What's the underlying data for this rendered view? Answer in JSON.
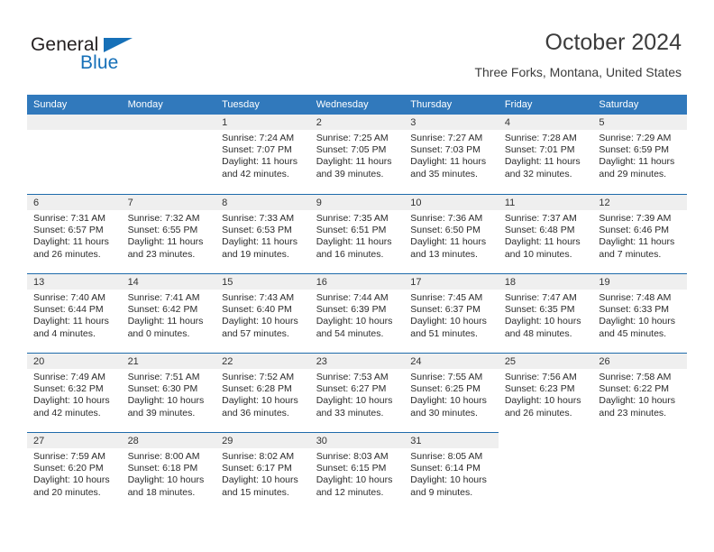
{
  "brand": {
    "line1": "General",
    "line2": "Blue",
    "flag_icon": "triangle-flag-icon",
    "colors": {
      "general": "#231f20",
      "blue": "#1670b8"
    }
  },
  "header": {
    "title": "October 2024",
    "subtitle": "Three Forks, Montana, United States"
  },
  "theme": {
    "header_blue": "#3179bc",
    "rule_blue": "#1f6bab",
    "daynum_band": "#efefef",
    "text": "#2b2b2b"
  },
  "weekday_headers": [
    "Sunday",
    "Monday",
    "Tuesday",
    "Wednesday",
    "Thursday",
    "Friday",
    "Saturday"
  ],
  "weeks": [
    [
      {
        "day": "",
        "filled": false,
        "lines": []
      },
      {
        "day": "",
        "filled": false,
        "lines": []
      },
      {
        "day": "1",
        "filled": true,
        "lines": [
          "Sunrise: 7:24 AM",
          "Sunset: 7:07 PM",
          "Daylight: 11 hours",
          "and 42 minutes."
        ]
      },
      {
        "day": "2",
        "filled": true,
        "lines": [
          "Sunrise: 7:25 AM",
          "Sunset: 7:05 PM",
          "Daylight: 11 hours",
          "and 39 minutes."
        ]
      },
      {
        "day": "3",
        "filled": true,
        "lines": [
          "Sunrise: 7:27 AM",
          "Sunset: 7:03 PM",
          "Daylight: 11 hours",
          "and 35 minutes."
        ]
      },
      {
        "day": "4",
        "filled": true,
        "lines": [
          "Sunrise: 7:28 AM",
          "Sunset: 7:01 PM",
          "Daylight: 11 hours",
          "and 32 minutes."
        ]
      },
      {
        "day": "5",
        "filled": true,
        "lines": [
          "Sunrise: 7:29 AM",
          "Sunset: 6:59 PM",
          "Daylight: 11 hours",
          "and 29 minutes."
        ]
      }
    ],
    [
      {
        "day": "6",
        "filled": true,
        "lines": [
          "Sunrise: 7:31 AM",
          "Sunset: 6:57 PM",
          "Daylight: 11 hours",
          "and 26 minutes."
        ]
      },
      {
        "day": "7",
        "filled": true,
        "lines": [
          "Sunrise: 7:32 AM",
          "Sunset: 6:55 PM",
          "Daylight: 11 hours",
          "and 23 minutes."
        ]
      },
      {
        "day": "8",
        "filled": true,
        "lines": [
          "Sunrise: 7:33 AM",
          "Sunset: 6:53 PM",
          "Daylight: 11 hours",
          "and 19 minutes."
        ]
      },
      {
        "day": "9",
        "filled": true,
        "lines": [
          "Sunrise: 7:35 AM",
          "Sunset: 6:51 PM",
          "Daylight: 11 hours",
          "and 16 minutes."
        ]
      },
      {
        "day": "10",
        "filled": true,
        "lines": [
          "Sunrise: 7:36 AM",
          "Sunset: 6:50 PM",
          "Daylight: 11 hours",
          "and 13 minutes."
        ]
      },
      {
        "day": "11",
        "filled": true,
        "lines": [
          "Sunrise: 7:37 AM",
          "Sunset: 6:48 PM",
          "Daylight: 11 hours",
          "and 10 minutes."
        ]
      },
      {
        "day": "12",
        "filled": true,
        "lines": [
          "Sunrise: 7:39 AM",
          "Sunset: 6:46 PM",
          "Daylight: 11 hours",
          "and 7 minutes."
        ]
      }
    ],
    [
      {
        "day": "13",
        "filled": true,
        "lines": [
          "Sunrise: 7:40 AM",
          "Sunset: 6:44 PM",
          "Daylight: 11 hours",
          "and 4 minutes."
        ]
      },
      {
        "day": "14",
        "filled": true,
        "lines": [
          "Sunrise: 7:41 AM",
          "Sunset: 6:42 PM",
          "Daylight: 11 hours",
          "and 0 minutes."
        ]
      },
      {
        "day": "15",
        "filled": true,
        "lines": [
          "Sunrise: 7:43 AM",
          "Sunset: 6:40 PM",
          "Daylight: 10 hours",
          "and 57 minutes."
        ]
      },
      {
        "day": "16",
        "filled": true,
        "lines": [
          "Sunrise: 7:44 AM",
          "Sunset: 6:39 PM",
          "Daylight: 10 hours",
          "and 54 minutes."
        ]
      },
      {
        "day": "17",
        "filled": true,
        "lines": [
          "Sunrise: 7:45 AM",
          "Sunset: 6:37 PM",
          "Daylight: 10 hours",
          "and 51 minutes."
        ]
      },
      {
        "day": "18",
        "filled": true,
        "lines": [
          "Sunrise: 7:47 AM",
          "Sunset: 6:35 PM",
          "Daylight: 10 hours",
          "and 48 minutes."
        ]
      },
      {
        "day": "19",
        "filled": true,
        "lines": [
          "Sunrise: 7:48 AM",
          "Sunset: 6:33 PM",
          "Daylight: 10 hours",
          "and 45 minutes."
        ]
      }
    ],
    [
      {
        "day": "20",
        "filled": true,
        "lines": [
          "Sunrise: 7:49 AM",
          "Sunset: 6:32 PM",
          "Daylight: 10 hours",
          "and 42 minutes."
        ]
      },
      {
        "day": "21",
        "filled": true,
        "lines": [
          "Sunrise: 7:51 AM",
          "Sunset: 6:30 PM",
          "Daylight: 10 hours",
          "and 39 minutes."
        ]
      },
      {
        "day": "22",
        "filled": true,
        "lines": [
          "Sunrise: 7:52 AM",
          "Sunset: 6:28 PM",
          "Daylight: 10 hours",
          "and 36 minutes."
        ]
      },
      {
        "day": "23",
        "filled": true,
        "lines": [
          "Sunrise: 7:53 AM",
          "Sunset: 6:27 PM",
          "Daylight: 10 hours",
          "and 33 minutes."
        ]
      },
      {
        "day": "24",
        "filled": true,
        "lines": [
          "Sunrise: 7:55 AM",
          "Sunset: 6:25 PM",
          "Daylight: 10 hours",
          "and 30 minutes."
        ]
      },
      {
        "day": "25",
        "filled": true,
        "lines": [
          "Sunrise: 7:56 AM",
          "Sunset: 6:23 PM",
          "Daylight: 10 hours",
          "and 26 minutes."
        ]
      },
      {
        "day": "26",
        "filled": true,
        "lines": [
          "Sunrise: 7:58 AM",
          "Sunset: 6:22 PM",
          "Daylight: 10 hours",
          "and 23 minutes."
        ]
      }
    ],
    [
      {
        "day": "27",
        "filled": true,
        "lines": [
          "Sunrise: 7:59 AM",
          "Sunset: 6:20 PM",
          "Daylight: 10 hours",
          "and 20 minutes."
        ]
      },
      {
        "day": "28",
        "filled": true,
        "lines": [
          "Sunrise: 8:00 AM",
          "Sunset: 6:18 PM",
          "Daylight: 10 hours",
          "and 18 minutes."
        ]
      },
      {
        "day": "29",
        "filled": true,
        "lines": [
          "Sunrise: 8:02 AM",
          "Sunset: 6:17 PM",
          "Daylight: 10 hours",
          "and 15 minutes."
        ]
      },
      {
        "day": "30",
        "filled": true,
        "lines": [
          "Sunrise: 8:03 AM",
          "Sunset: 6:15 PM",
          "Daylight: 10 hours",
          "and 12 minutes."
        ]
      },
      {
        "day": "31",
        "filled": true,
        "lines": [
          "Sunrise: 8:05 AM",
          "Sunset: 6:14 PM",
          "Daylight: 10 hours",
          "and 9 minutes."
        ]
      },
      {
        "day": "",
        "filled": false,
        "lines": []
      },
      {
        "day": "",
        "filled": false,
        "lines": []
      }
    ]
  ]
}
